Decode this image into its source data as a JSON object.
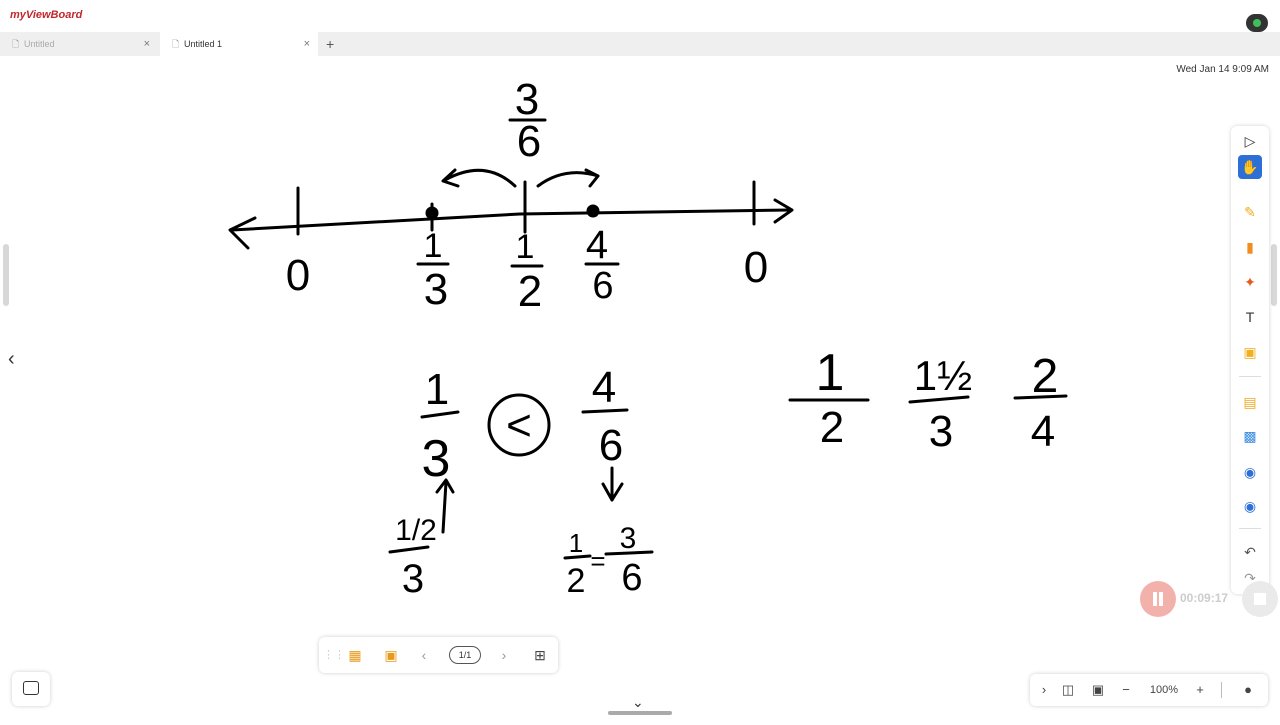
{
  "app": {
    "logo": "myViewBoard"
  },
  "tabs": [
    {
      "label": "Untitled",
      "active": false
    },
    {
      "label": "Untitled 1",
      "active": true
    }
  ],
  "datetime": "Wed Jan 14 9:09 AM",
  "whiteboard": {
    "number_line_labels": [
      "3",
      "6",
      "0",
      "1",
      "3",
      "1",
      "2",
      "4",
      "6",
      "0"
    ],
    "comparison": {
      "left_num": "1",
      "left_den": "3",
      "symbol": "<",
      "right_num": "4",
      "right_den": "6"
    },
    "left_note": {
      "num": "1/2",
      "den": "3"
    },
    "right_note": {
      "a_num": "1",
      "a_den": "2",
      "sep": "=",
      "b_num": "3",
      "b_den": "6"
    },
    "fractions_row": [
      {
        "num": "1",
        "den": "2"
      },
      {
        "num": "1½",
        "den": "3"
      },
      {
        "num": "2",
        "den": "4"
      }
    ]
  },
  "right_toolbar": {
    "tools": [
      "select-icon",
      "hand-icon",
      "pen-icon",
      "highlighter-icon",
      "magic-pen-icon",
      "text-icon",
      "sticky-note-icon",
      "folder-icon",
      "media-icon",
      "embed-browser-icon",
      "screen-capture-icon",
      "undo-icon",
      "redo-icon"
    ]
  },
  "recorder": {
    "time": "00:09:17"
  },
  "bottom_toolbar": {
    "page": "1/1"
  },
  "zoom": {
    "level": "100%"
  },
  "colors": {
    "accent": "#2c6fd6",
    "logo_red": "#c0282d",
    "record_pause": "#f3b1ac"
  }
}
